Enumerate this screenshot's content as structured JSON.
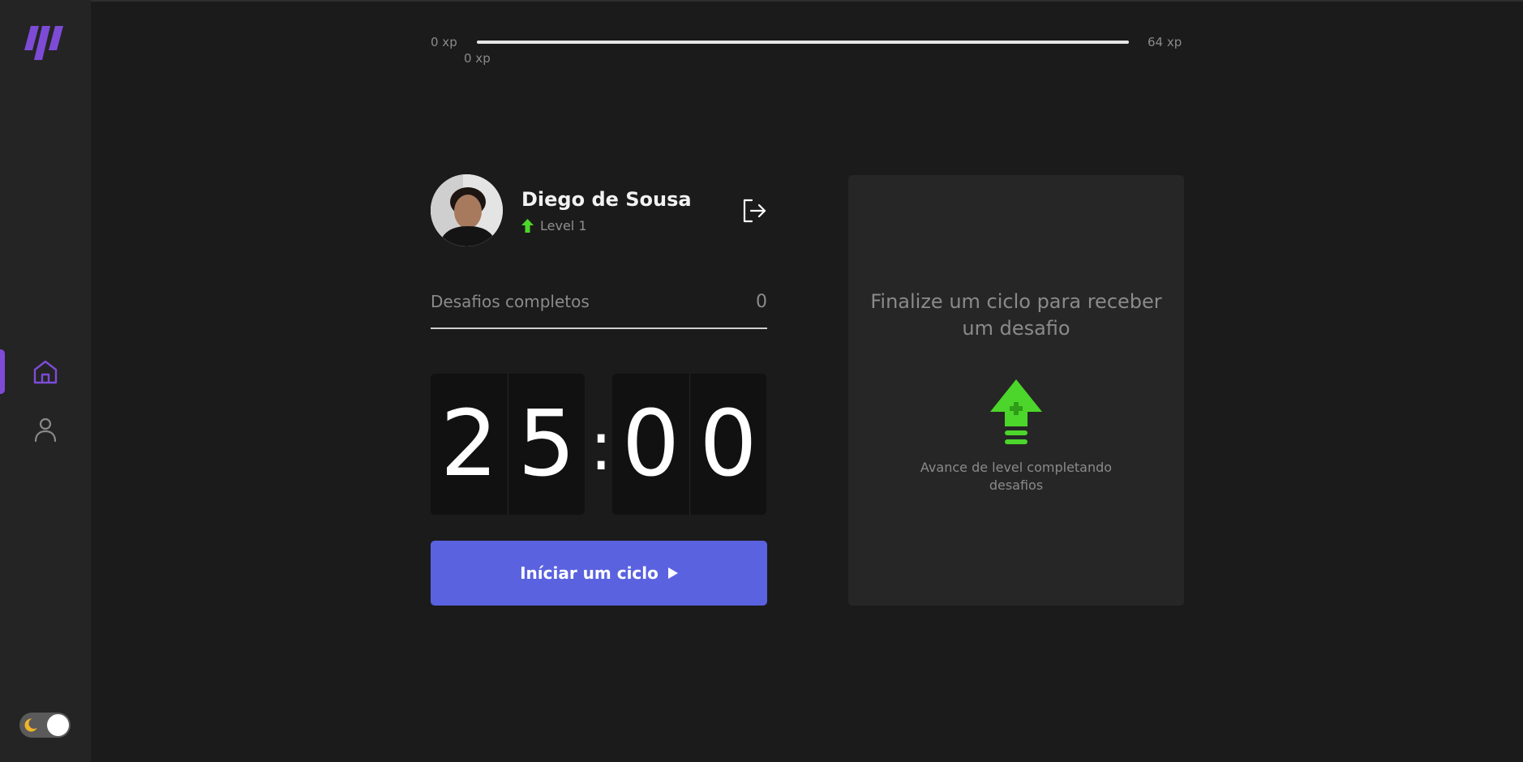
{
  "colors": {
    "accent": "#5a62e0",
    "brand": "#7d4bd6",
    "level_green": "#4cd62b",
    "background": "#1b1b1b",
    "sidebar": "#242424",
    "card": "#262626"
  },
  "sidebar": {
    "logo_icon": "brand-slashes-logo",
    "items": [
      {
        "icon": "home-icon",
        "active": true
      },
      {
        "icon": "user-icon",
        "active": false
      }
    ],
    "theme_toggle": {
      "icon": "moon-icon",
      "state": "dark"
    }
  },
  "xp_bar": {
    "min_label": "0 xp",
    "max_label": "64 xp",
    "current_label": "0 xp",
    "progress": 1.0
  },
  "profile": {
    "name": "Diego de Sousa",
    "level_label": "Level 1",
    "logout_icon": "logout-icon"
  },
  "challenges": {
    "label": "Desafios completos",
    "count": "0"
  },
  "countdown": {
    "minute_left": "2",
    "minute_right": "5",
    "separator": ":",
    "second_left": "0",
    "second_right": "0"
  },
  "start_button": {
    "label": "Iníciar um ciclo",
    "icon": "play-icon"
  },
  "challenge_card": {
    "title": "Finalize um ciclo para receber um desafio",
    "icon": "level-up-arrow-icon",
    "text": "Avance de level completando desafios"
  }
}
